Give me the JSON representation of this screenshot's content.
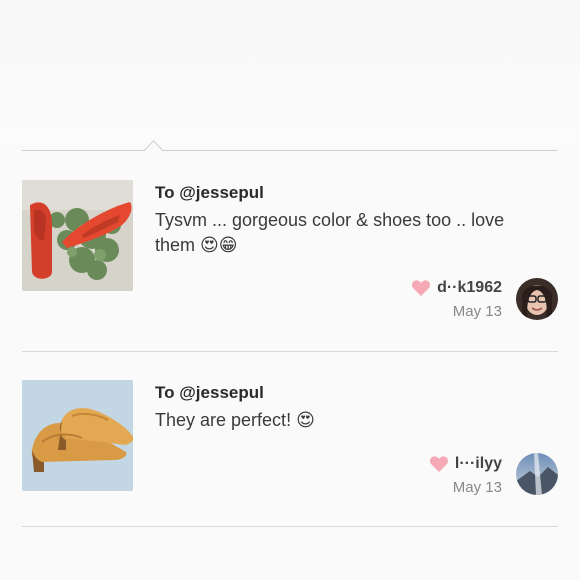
{
  "comments": [
    {
      "to": "To @jessepul",
      "message": "Tysvm ... gorgeous color & shoes too .. love them 😍😁",
      "username": "d··k1962",
      "date": "May 13"
    },
    {
      "to": "To @jessepul",
      "message": "They are perfect! 😍",
      "username": "l···ilyy",
      "date": "May 13"
    }
  ],
  "icons": {
    "heart": "heart-icon",
    "heart_color": "#f4a9b4"
  }
}
